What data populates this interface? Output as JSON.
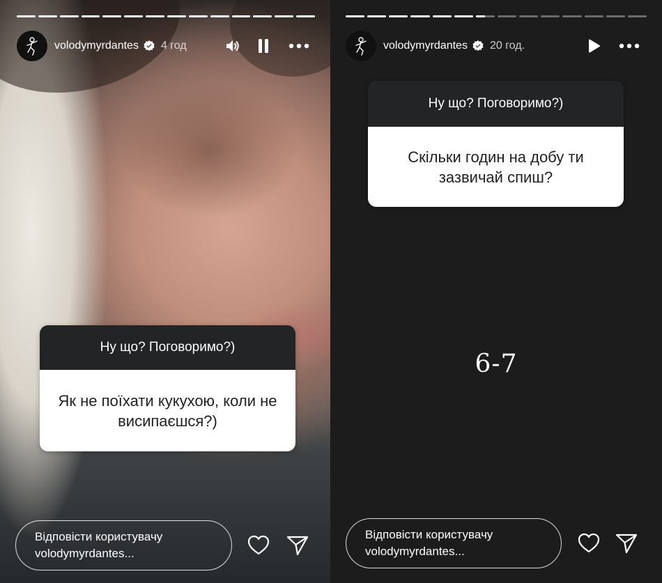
{
  "stories": [
    {
      "username": "volodymyrdantes",
      "time": "4 год",
      "progress": {
        "completed_segments": 14,
        "current_segment_fraction": 1.0,
        "total_segments": 14
      },
      "question_title": "Ну що? Поговоримо?)",
      "question_text": "Як не поїхати кукухою, коли не висипаєшся?)",
      "reply_line1": "Відповісти користувачу",
      "reply_line2": "volodymyrdantes..."
    },
    {
      "username": "volodymyrdantes",
      "time": "20 год.",
      "progress": {
        "completed_segments": 6,
        "current_segment_fraction": 0.5,
        "total_segments": 14
      },
      "question_title": "Ну що? Поговоримо?)",
      "question_text": "Скільки годин на добу ти зазвичай спиш?",
      "answer": "6-7",
      "reply_line1": "Відповісти користувачу",
      "reply_line2": "volodymyrdantes..."
    }
  ],
  "icons": {
    "avatar": "dancer-logo-icon",
    "verified": "verified-badge-icon",
    "sound": "speaker-icon",
    "pause": "pause-icon",
    "play": "play-icon",
    "more": "more-dots-icon",
    "like": "heart-icon",
    "share": "send-icon"
  },
  "colors": {
    "question_header": "#232426",
    "right_background": "#1c1c1c",
    "verified_badge": "#ffffff"
  }
}
